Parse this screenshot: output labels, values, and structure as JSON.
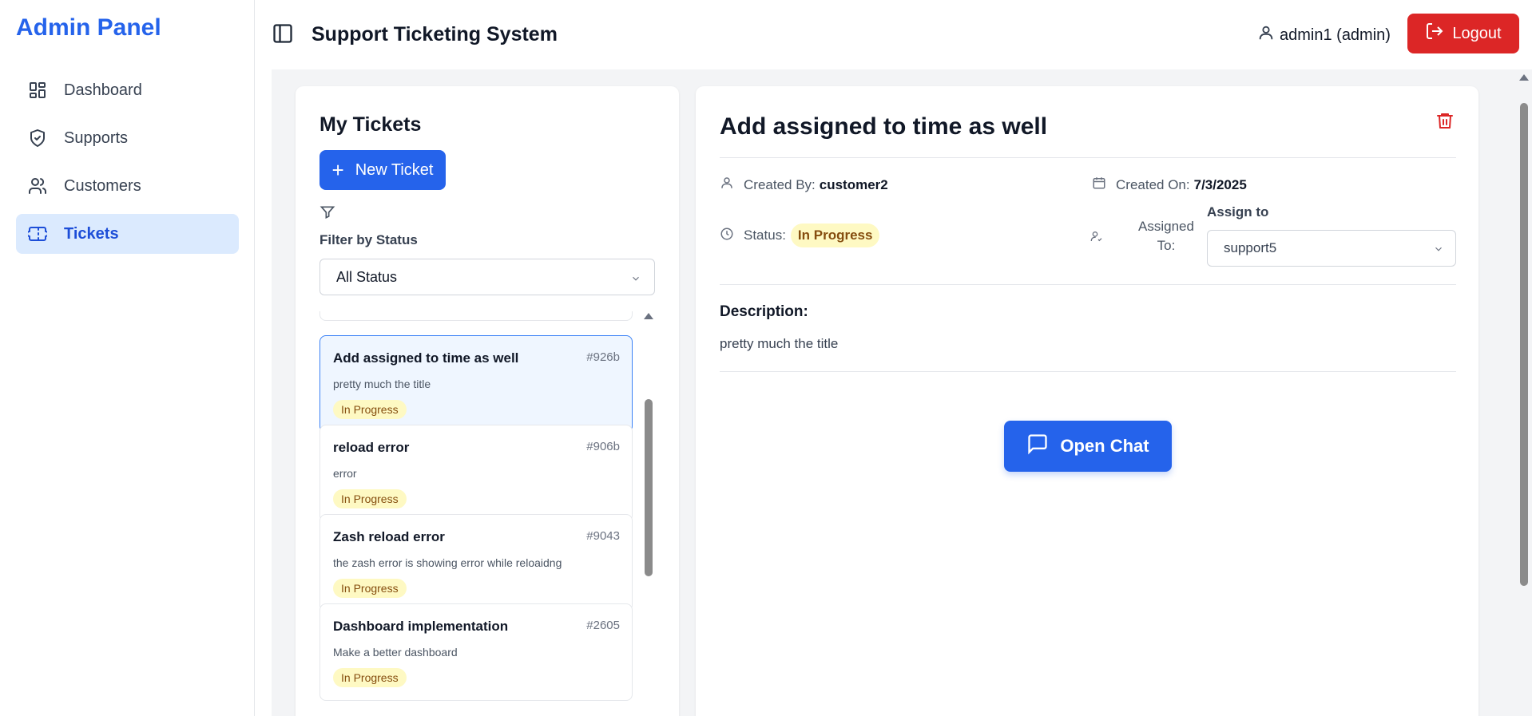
{
  "sidebar": {
    "brand": "Admin Panel",
    "items": [
      {
        "label": "Dashboard",
        "icon": "dashboard-icon"
      },
      {
        "label": "Supports",
        "icon": "shield-icon"
      },
      {
        "label": "Customers",
        "icon": "users-icon"
      },
      {
        "label": "Tickets",
        "icon": "ticket-icon",
        "active": true
      }
    ]
  },
  "header": {
    "title": "Support Ticketing System",
    "user": "admin1 (admin)",
    "logout_label": "Logout"
  },
  "ticket_list": {
    "title": "My Tickets",
    "new_ticket_label": "New Ticket",
    "filter_label": "Filter by Status",
    "filter_value": "All Status",
    "tickets": [
      {
        "title": "Add assigned to time as well",
        "id": "#926b",
        "description": "pretty much the title",
        "status": "In Progress"
      },
      {
        "title": "reload error",
        "id": "#906b",
        "description": "error",
        "status": "In Progress"
      },
      {
        "title": "Zash reload error",
        "id": "#9043",
        "description": "the zash error is showing error while reloaidng",
        "status": "In Progress"
      },
      {
        "title": "Dashboard implementation",
        "id": "#2605",
        "description": "Make a better dashboard",
        "status": "In Progress"
      }
    ]
  },
  "detail": {
    "title": "Add assigned to time as well",
    "created_by_label": "Created By:",
    "created_by": "customer2",
    "created_on_label": "Created On:",
    "created_on": "7/3/2025",
    "status_label": "Status:",
    "status": "In Progress",
    "assigned_to_label": "Assigned To:",
    "assign_to_label": "Assign to",
    "assign_to_value": "support5",
    "description_label": "Description:",
    "description": "pretty much the title",
    "open_chat_label": "Open Chat"
  },
  "colors": {
    "brand": "#2563eb",
    "danger": "#dc2626",
    "active_nav_bg": "#dbeafe",
    "status_badge_bg": "#fef9c3",
    "status_badge_text": "#854d0e"
  }
}
